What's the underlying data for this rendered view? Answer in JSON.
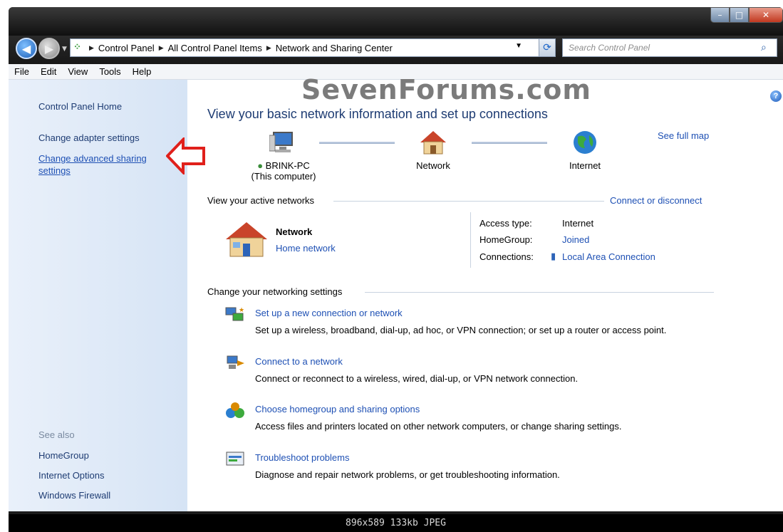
{
  "window": {
    "controls": {
      "minimize": "–",
      "maximize": "□",
      "close": "✕"
    }
  },
  "nav": {
    "back_icon": "back-arrow-icon",
    "forward_icon": "forward-arrow-icon",
    "breadcrumbs": [
      "Control Panel",
      "All Control Panel Items",
      "Network and Sharing Center"
    ],
    "search_placeholder": "Search Control Panel"
  },
  "menu": [
    "File",
    "Edit",
    "View",
    "Tools",
    "Help"
  ],
  "watermark": "SevenForums.com",
  "sidebar": {
    "items": [
      "Control Panel Home",
      "Change adapter settings",
      "Change advanced sharing settings"
    ],
    "see_also_label": "See also",
    "see_also": [
      "HomeGroup",
      "Internet Options",
      "Windows Firewall"
    ]
  },
  "main": {
    "heading": "View your basic network information and set up connections",
    "see_full_map": "See full map",
    "map": {
      "computer_name": "BRINK-PC",
      "computer_sub": "(This computer)",
      "network": "Network",
      "internet": "Internet"
    },
    "active_networks_title": "View your active networks",
    "connect_disconnect": "Connect or disconnect",
    "network_name": "Network",
    "network_type": "Home network",
    "access_type_label": "Access type:",
    "access_type_value": "Internet",
    "homegroup_label": "HomeGroup:",
    "homegroup_value": "Joined",
    "connections_label": "Connections:",
    "connections_value": "Local Area Connection",
    "settings_title": "Change your networking settings",
    "tasks": [
      {
        "title": "Set up a new connection or network",
        "desc": "Set up a wireless, broadband, dial-up, ad hoc, or VPN connection; or set up a router or access point."
      },
      {
        "title": "Connect to a network",
        "desc": "Connect or reconnect to a wireless, wired, dial-up, or VPN network connection."
      },
      {
        "title": "Choose homegroup and sharing options",
        "desc": "Access files and printers located on other network computers, or change sharing settings."
      },
      {
        "title": "Troubleshoot problems",
        "desc": "Diagnose and repair network problems, or get troubleshooting information."
      }
    ]
  },
  "status": "896x589  133kb  JPEG",
  "colors": {
    "link": "#1e50b4",
    "heading": "#1e3c73",
    "arrow": "#e0201b"
  }
}
